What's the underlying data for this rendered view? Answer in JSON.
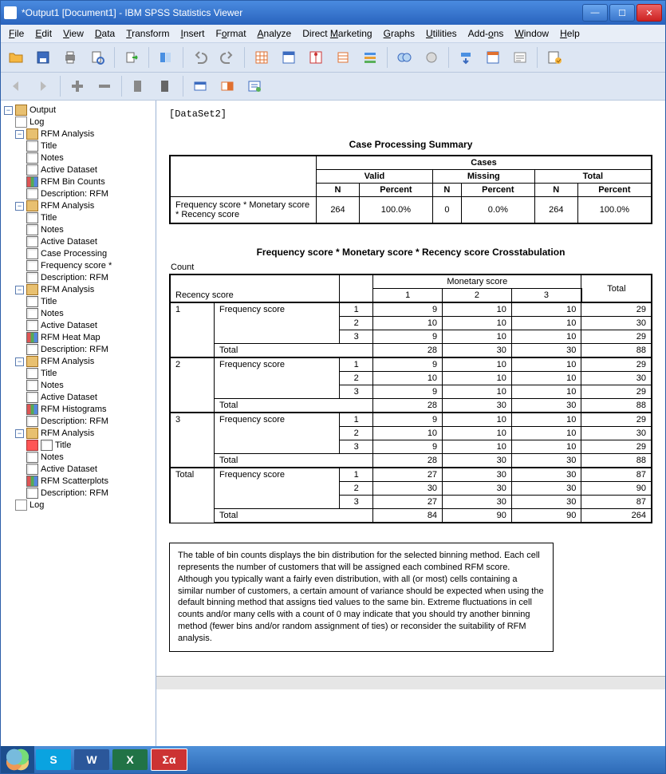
{
  "window": {
    "title": "*Output1 [Document1] - IBM SPSS Statistics Viewer"
  },
  "menus": {
    "file": "File",
    "edit": "Edit",
    "view": "View",
    "data": "Data",
    "transform": "Transform",
    "insert": "Insert",
    "format": "Format",
    "analyze": "Analyze",
    "direct": "Direct Marketing",
    "graphs": "Graphs",
    "utilities": "Utilities",
    "addons": "Add-ons",
    "windowm": "Window",
    "help": "Help"
  },
  "outline": {
    "root": "Output",
    "log": "Log",
    "rfm": "RFM Analysis",
    "title": "Title",
    "notes": "Notes",
    "active": "Active Dataset",
    "bincounts": "RFM Bin Counts",
    "desc": "Description: RFM",
    "caseproc": "Case Processing",
    "freq": "Frequency score *",
    "heatmap": "RFM Heat Map",
    "histograms": "RFM Histograms",
    "scatter": "RFM Scatterplots"
  },
  "viewer": {
    "dataset": "[DataSet2]",
    "caseproc": {
      "title": "Case Processing Summary",
      "cases": "Cases",
      "valid": "Valid",
      "missing": "Missing",
      "total": "Total",
      "n": "N",
      "percent": "Percent",
      "rowlabel": "Frequency score * Monetary score * Recency score",
      "valid_n": "264",
      "valid_p": "100.0%",
      "miss_n": "0",
      "miss_p": "0.0%",
      "tot_n": "264",
      "tot_p": "100.0%"
    },
    "crosstab": {
      "title": "Frequency score * Monetary score * Recency score Crosstabulation",
      "count": "Count",
      "recency": "Recency score",
      "frequency": "Frequency score",
      "monetary": "Monetary score",
      "totallbl": "Total"
    },
    "description": "The table of bin counts displays the bin distribution for the selected binning method. Each cell represents the number of customers that will be assigned each combined RFM score. Although you typically want a fairly even distribution, with all (or most) cells containing a similar number of customers, a certain amount of variance should be expected when using the default binning method that assigns tied values to the same bin. Extreme fluctuations in cell counts and/or many cells with a count of 0 may indicate that you should try another binning method (fewer bins and/or random assignment of ties) or reconsider the suitability of RFM analysis."
  },
  "chart_data": {
    "type": "table",
    "title": "Frequency score * Monetary score * Recency score Crosstabulation",
    "col_labels": [
      "Monetary 1",
      "Monetary 2",
      "Monetary 3",
      "Total"
    ],
    "groups": [
      {
        "recency": "1",
        "rows": [
          {
            "freq": "1",
            "v": [
              9,
              10,
              10,
              29
            ]
          },
          {
            "freq": "2",
            "v": [
              10,
              10,
              10,
              30
            ]
          },
          {
            "freq": "3",
            "v": [
              9,
              10,
              10,
              29
            ]
          },
          {
            "freq": "Total",
            "v": [
              28,
              30,
              30,
              88
            ]
          }
        ]
      },
      {
        "recency": "2",
        "rows": [
          {
            "freq": "1",
            "v": [
              9,
              10,
              10,
              29
            ]
          },
          {
            "freq": "2",
            "v": [
              10,
              10,
              10,
              30
            ]
          },
          {
            "freq": "3",
            "v": [
              9,
              10,
              10,
              29
            ]
          },
          {
            "freq": "Total",
            "v": [
              28,
              30,
              30,
              88
            ]
          }
        ]
      },
      {
        "recency": "3",
        "rows": [
          {
            "freq": "1",
            "v": [
              9,
              10,
              10,
              29
            ]
          },
          {
            "freq": "2",
            "v": [
              10,
              10,
              10,
              30
            ]
          },
          {
            "freq": "3",
            "v": [
              9,
              10,
              10,
              29
            ]
          },
          {
            "freq": "Total",
            "v": [
              28,
              30,
              30,
              88
            ]
          }
        ]
      },
      {
        "recency": "Total",
        "rows": [
          {
            "freq": "1",
            "v": [
              27,
              30,
              30,
              87
            ]
          },
          {
            "freq": "2",
            "v": [
              30,
              30,
              30,
              90
            ]
          },
          {
            "freq": "3",
            "v": [
              27,
              30,
              30,
              87
            ]
          },
          {
            "freq": "Total",
            "v": [
              84,
              90,
              90,
              264
            ]
          }
        ]
      }
    ]
  }
}
